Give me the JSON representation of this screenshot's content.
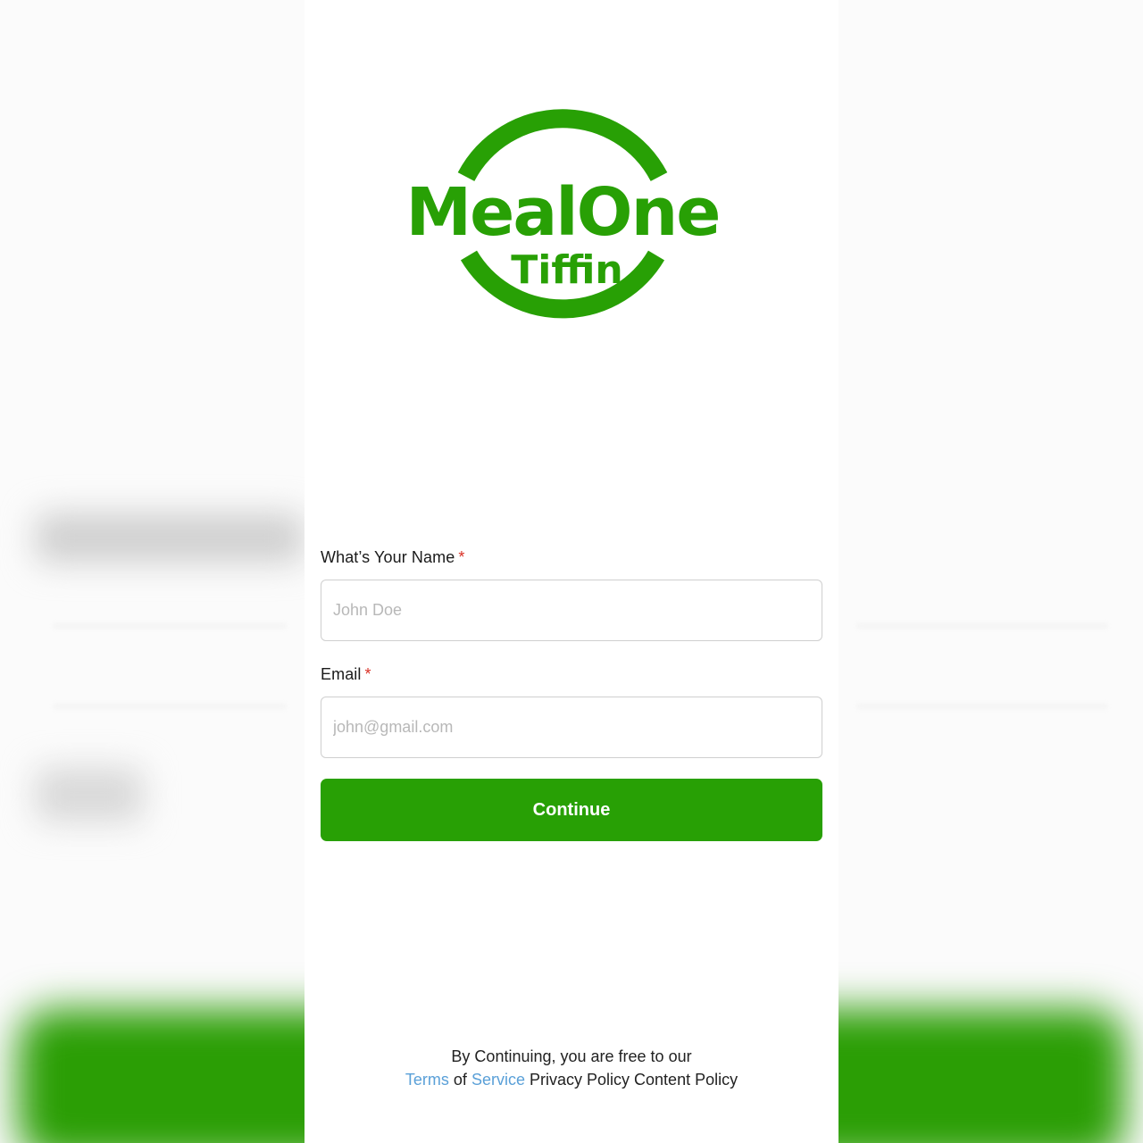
{
  "brand": {
    "name": "MealOne",
    "subname": "Tiffin",
    "color": "#28a005"
  },
  "form": {
    "name_label": "What’s Your Name",
    "name_placeholder": "John Doe",
    "email_label": "Email",
    "email_placeholder": "john@gmail.com",
    "required_marker": "*",
    "continue_label": "Continue"
  },
  "footer": {
    "line1": "By Continuing, you are free to our",
    "terms": "Terms",
    "of": "of",
    "service": "Service",
    "privacy": "Privacy Policy",
    "content": "Content Policy"
  }
}
